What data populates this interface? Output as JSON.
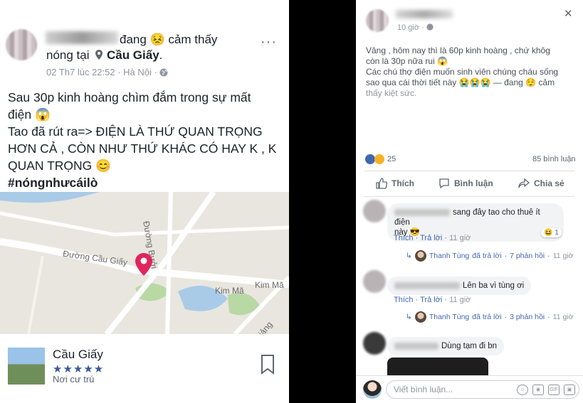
{
  "left_post": {
    "header_line1": "đang 😣 cảm thấy",
    "header_line2_prefix": "nóng tại",
    "place": "Cầu Giấy",
    "meta": "02 Th7 lúc 22:52 · Hà Nội · ",
    "globe_icon": "globe-icon",
    "more_label": "···",
    "body_lines": [
      "Sau 30p kinh hoàng chìm đắm trong sự mất",
      "điện 😱",
      "Tao đã rút ra=> ĐIỆN LÀ THỨ QUAN TRỌNG",
      "HƠN CẢ , CÒN NHƯ THỨ KHÁC CÓ HAY K , K",
      "QUAN TRỌNG 😊"
    ],
    "hashtag": "#nóngnhưcáilò",
    "map": {
      "labels": [
        "Đường Cầu Giấy",
        "Đường Bưởi",
        "Kim Mã",
        "Kim Mã",
        "Giảng Võ"
      ],
      "pin_color": "#e0245e"
    },
    "location_card": {
      "name": "Cầu Giấy",
      "stars": "★★★★★",
      "rating_fraction": 0.9,
      "subtitle": "Nơi cư trú"
    }
  },
  "right_post": {
    "time": "10 giờ · ",
    "close_label": "✕",
    "body_lines": [
      "Vâng , hôm nay thì là 60p kinh hoàng , chứ khôg",
      "còn là 30p nữa rui 😱",
      "Các chú thợ điện muốn sinh viên chúng cháu sống",
      "sao qua cái thời tiết này 😭😭😭 — đang 😌 cảm",
      "thấy kiệt sức."
    ],
    "reaction_count": "25",
    "comment_count": "85 bình luận",
    "actions": {
      "like": "Thích",
      "comment": "Bình luận",
      "share": "Chia sẻ"
    },
    "comments": [
      {
        "text": "sang đây tao cho thuê ít điện",
        "text2": "này 😎",
        "like": "Thích",
        "reply": "Trả lời",
        "time": "11 giờ",
        "reaction": "1",
        "replies_line": {
          "name": "Thanh Tùng",
          "action": "đã trả lời",
          "count": "7 phản hồi",
          "time": "11 giờ"
        }
      },
      {
        "text": "Lên ba vì tùng ơi",
        "like": "Thích",
        "reply": "Trả lời",
        "time": "11 giờ",
        "replies_line": {
          "name": "Thanh Tùng",
          "action": "đã trả lời",
          "count": "3 phản hồi",
          "time": "11 giờ"
        }
      },
      {
        "text": "Dùng tạm đi bn"
      }
    ],
    "write_placeholder": "Viết bình luận...",
    "accent": "#4267b2"
  }
}
